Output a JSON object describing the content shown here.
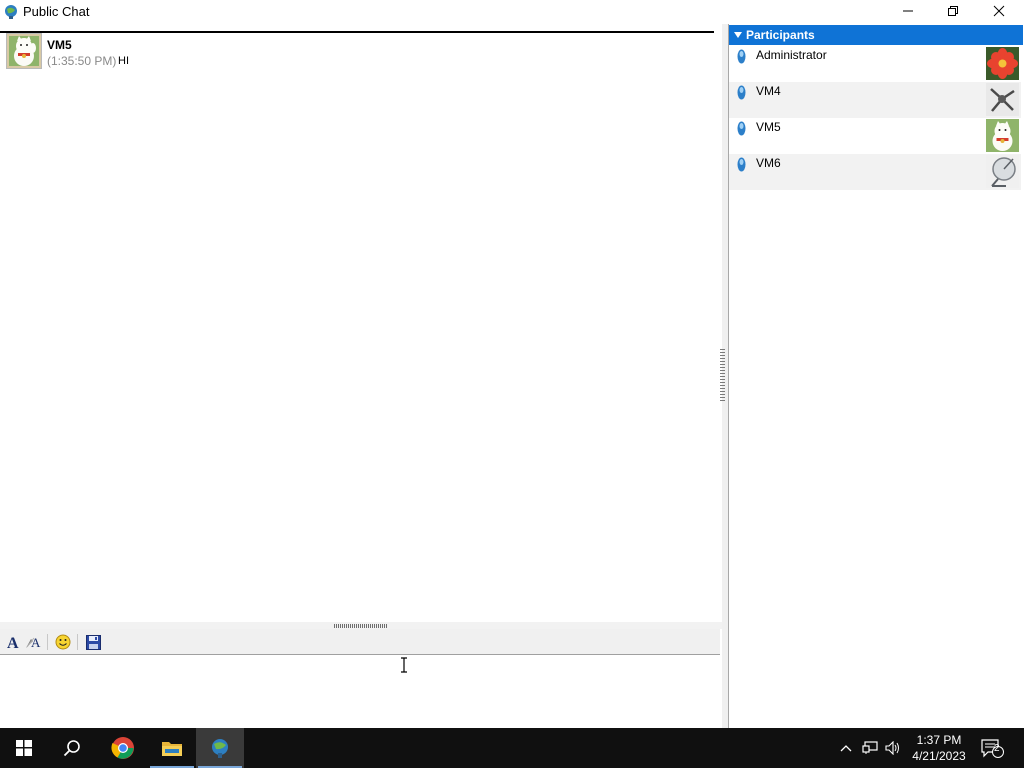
{
  "window": {
    "title": "Public Chat",
    "controls": [
      "minimize-icon",
      "restore-icon",
      "close-icon"
    ]
  },
  "chat": {
    "messages": [
      {
        "sender": "VM5",
        "time": "(1:35:50 PM)",
        "text": "HI",
        "avatar": "lucky-cat-avatar"
      }
    ]
  },
  "toolbar": {
    "items": [
      "font-icon",
      "font-style-icon",
      "emoticon-icon",
      "save-icon"
    ]
  },
  "input": {
    "value": "",
    "placeholder": ""
  },
  "participants": {
    "header": "Participants",
    "items": [
      {
        "name": "Administrator",
        "avatar": "flower-avatar"
      },
      {
        "name": "VM4",
        "avatar": "chess-piece-avatar"
      },
      {
        "name": "VM5",
        "avatar": "lucky-cat-avatar"
      },
      {
        "name": "VM6",
        "avatar": "satellite-dish-avatar"
      }
    ]
  },
  "taskbar": {
    "apps": [
      "start-icon",
      "search-icon",
      "chrome-icon",
      "file-explorer-icon",
      "chat-app-icon"
    ],
    "clock": {
      "time": "1:37 PM",
      "date": "4/21/2023"
    },
    "notification_count": "2"
  },
  "colors": {
    "accent": "#0f73d6",
    "taskbar": "#101010",
    "timestamp": "#8a8a8a"
  }
}
